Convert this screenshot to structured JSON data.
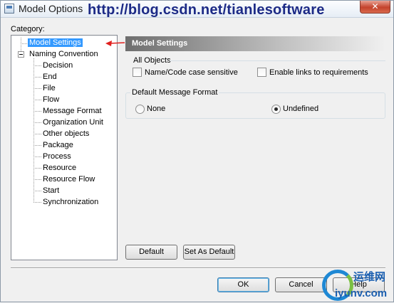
{
  "window": {
    "title": "Model Options",
    "watermark_url": "http://blog.csdn.net/tianlesoftware",
    "close_glyph": "✕"
  },
  "category_label": "Category:",
  "tree": {
    "items": [
      {
        "label": "Model Settings",
        "selected": true
      },
      {
        "label": "Naming Convention",
        "expanded": true
      },
      {
        "label": "Decision"
      },
      {
        "label": "End"
      },
      {
        "label": "File"
      },
      {
        "label": "Flow"
      },
      {
        "label": "Message Format"
      },
      {
        "label": "Organization Unit"
      },
      {
        "label": "Other objects"
      },
      {
        "label": "Package"
      },
      {
        "label": "Process"
      },
      {
        "label": "Resource"
      },
      {
        "label": "Resource Flow"
      },
      {
        "label": "Start"
      },
      {
        "label": "Synchronization"
      }
    ],
    "arrow_color": "#e0201e"
  },
  "settings": {
    "header": "Model Settings",
    "all_objects": {
      "title": "All Objects",
      "name_code_case_sensitive": {
        "label": "Name/Code case sensitive",
        "checked": false
      },
      "enable_links": {
        "label": "Enable links to requirements",
        "checked": false
      }
    },
    "message_format": {
      "title": "Default Message Format",
      "none": {
        "label": "None",
        "checked": false
      },
      "undefined": {
        "label": "Undefined",
        "checked": true
      }
    },
    "default_label": "Default",
    "set_as_default_label": "Set As Default"
  },
  "footer": {
    "ok_label": "OK",
    "cancel_label": "Cancel",
    "help_label": "Help"
  },
  "site_logo": {
    "cn": "运维网",
    "en": "iyunv.com"
  }
}
